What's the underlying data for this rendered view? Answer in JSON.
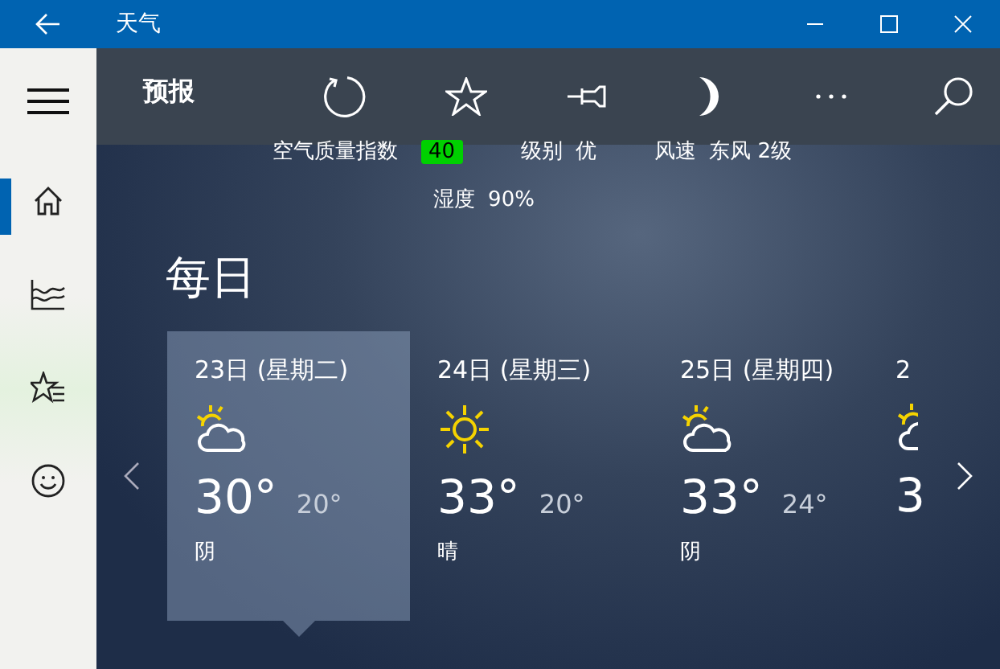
{
  "window": {
    "title": "天气"
  },
  "toolbar": {
    "title": "预报"
  },
  "sidebar": {
    "items": [
      {
        "kind": "home",
        "selected": true
      },
      {
        "kind": "chart",
        "selected": false
      },
      {
        "kind": "favorites",
        "selected": false
      },
      {
        "kind": "feedback",
        "selected": false
      }
    ]
  },
  "conditions": {
    "aqi_label": "空气质量指数",
    "aqi_value": "40",
    "level_label": "级别",
    "level_value": "优",
    "wind_label": "风速",
    "wind_value": "东风 2级",
    "humidity_label": "湿度",
    "humidity_value": "90%"
  },
  "daily": {
    "heading": "每日",
    "days": [
      {
        "date": "23日 (星期二)",
        "kind": "partly-cloudy",
        "high": "30°",
        "low": "20°",
        "condition": "阴",
        "selected": true
      },
      {
        "date": "24日 (星期三)",
        "kind": "sunny",
        "high": "33°",
        "low": "20°",
        "condition": "晴",
        "selected": false
      },
      {
        "date": "25日 (星期四)",
        "kind": "partly-cloudy",
        "high": "33°",
        "low": "24°",
        "condition": "阴",
        "selected": false
      },
      {
        "date": "2",
        "kind": "partly-cloudy",
        "high": "3",
        "selected": false
      }
    ]
  }
}
